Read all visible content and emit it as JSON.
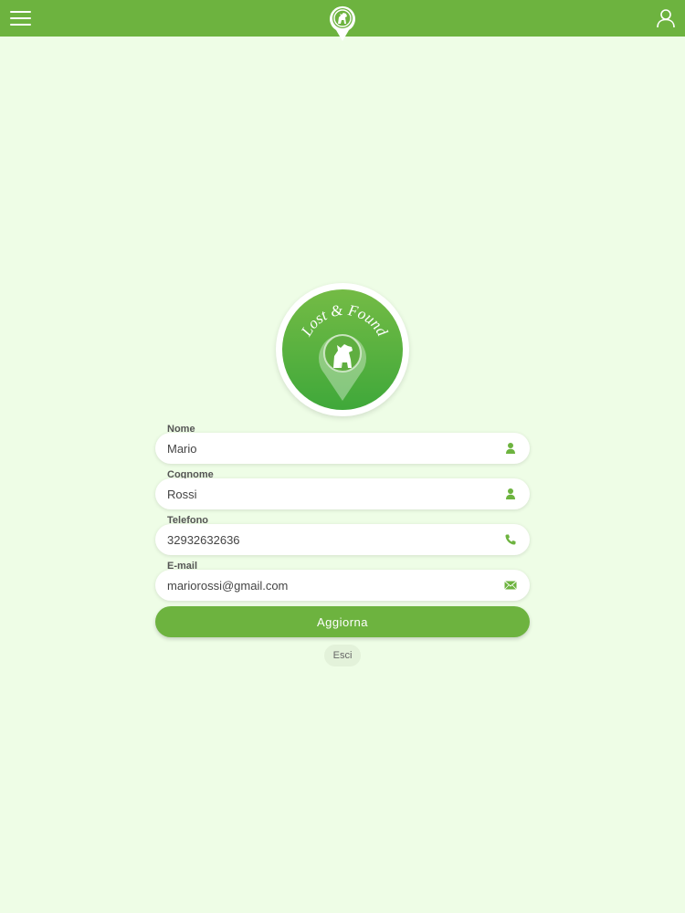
{
  "colors": {
    "accent": "#6db33f",
    "background": "#eefde6",
    "field_bg": "#ffffff",
    "secondary_button_bg": "#e3f2da"
  },
  "header": {
    "menu_icon": "hamburger-menu-icon",
    "logo_icon": "pet-pin-logo-icon",
    "user_icon": "user-profile-icon"
  },
  "logo": {
    "text": "Lost & Found"
  },
  "form": {
    "fields": [
      {
        "label": "Nome",
        "value": "Mario",
        "icon": "person-icon"
      },
      {
        "label": "Cognome",
        "value": "Rossi",
        "icon": "person-icon"
      },
      {
        "label": "Telefono",
        "value": "32932632636",
        "icon": "phone-icon"
      },
      {
        "label": "E-mail",
        "value": "mariorossi@gmail.com",
        "icon": "envelope-icon"
      }
    ],
    "submit_label": "Aggiorna",
    "logout_label": "Esci"
  }
}
